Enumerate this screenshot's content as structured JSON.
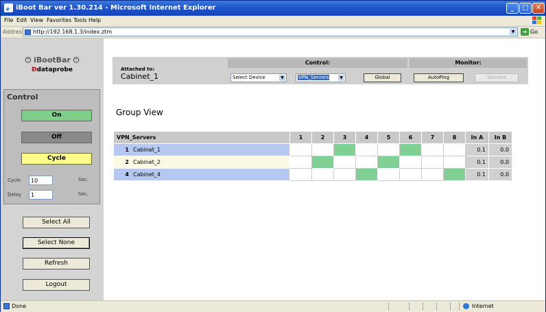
{
  "window": {
    "title": "iBoot Bar ver 1.30.214 - Microsoft Internet Explorer",
    "menu": [
      "File",
      "Edit",
      "View",
      "Favorites",
      "Tools",
      "Help"
    ]
  },
  "address": {
    "label": "Address",
    "url": "http://192.168.1.3/index.ztm",
    "go": "Go"
  },
  "logo": {
    "line1": "iBootBar",
    "line2": "dataprobe"
  },
  "control": {
    "header": "Control",
    "on_label": "On",
    "off_label": "Off",
    "cycle_label": "Cycle",
    "cycle_field": {
      "label": "Cycle",
      "value": "10",
      "unit": "Sec."
    },
    "delay_field": {
      "label": "Delay",
      "value": "1",
      "unit": "Sec."
    }
  },
  "sidebar_buttons": {
    "select_all": "Select All",
    "select_none": "Select None",
    "refresh": "Refresh",
    "logout": "Logout"
  },
  "topbar": {
    "attached_label": "Attached to:",
    "attached_value": "Cabinet_1",
    "control_header": "Control:",
    "monitor_header": "Monitor:",
    "select_device": "Select Device",
    "group_select": "VPN_Servers",
    "global_button": "Global",
    "autoping_button": "AutoPing",
    "sensors_button": "Sensors"
  },
  "group_view_title": "Group View",
  "grid": {
    "group_name": "VPN_Servers",
    "outlet_headers": [
      "1",
      "2",
      "3",
      "4",
      "5",
      "6",
      "7",
      "8"
    ],
    "in_a_header": "In A",
    "in_b_header": "In B",
    "rows": [
      {
        "num": "1",
        "name": "Cabinet_1",
        "on": [
          3,
          6
        ],
        "in_a": "0.1",
        "in_b": "0.0"
      },
      {
        "num": "2",
        "name": "Cabinet_2",
        "on": [
          2,
          5
        ],
        "in_a": "0.1",
        "in_b": "0.0"
      },
      {
        "num": "4",
        "name": "Cabinet_4",
        "on": [
          4,
          8
        ],
        "in_a": "0.1",
        "in_b": "0.0"
      }
    ]
  },
  "status": {
    "left": "Done",
    "zone": "Internet"
  },
  "colors": {
    "on_green": "#80cf93",
    "cycle_yellow": "#ffff88",
    "row_blue": "#b5c8f1"
  }
}
